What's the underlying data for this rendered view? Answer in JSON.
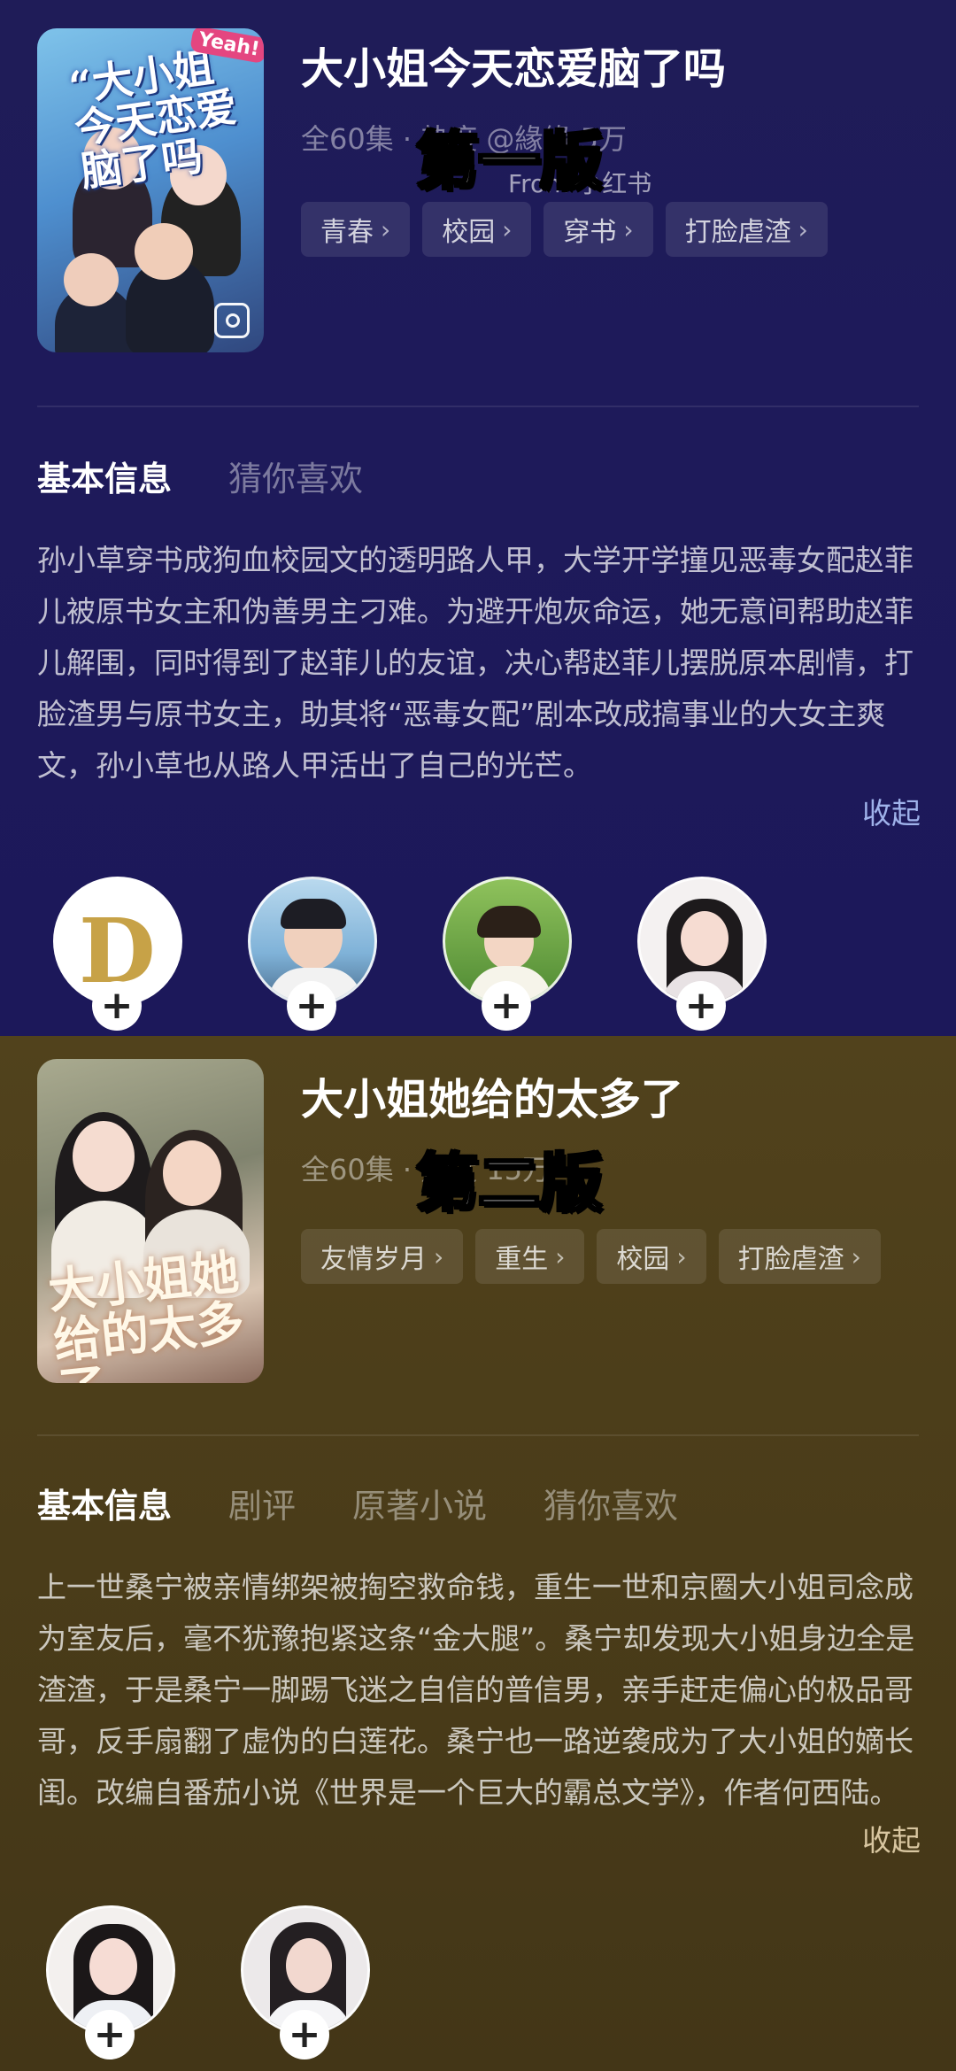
{
  "version1": {
    "title": "大小姐今天恋爱脑了吗",
    "meta": "全60集 · 热度 @緣緣 5万",
    "from": "From 小红书",
    "overlay": "第一版",
    "poster_caption": "“大小姐今天恋爱脑了吗",
    "poster_tag": "Yeah!",
    "tags": [
      "青春",
      "校园",
      "穿书",
      "打脸虐渣"
    ],
    "tabs": [
      "基本信息",
      "猜你喜欢"
    ],
    "synopsis": "孙小草穿书成狗血校园文的透明路人甲，大学开学撞见恶毒女配赵菲儿被原书女主和伪善男主刁难。为避开炮灰命运，她无意间帮助赵菲儿解围，同时得到了赵菲儿的友谊，决心帮赵菲儿摆脱原本剧情，打脸渣男与原书女主，助其将“恶毒女配”剧本改成搞事业的大女主爽文，孙小草也从路人甲活出了自己的光芒。",
    "collapse": "收起",
    "avatars": [
      "avatar-1",
      "avatar-2",
      "avatar-3",
      "avatar-4"
    ]
  },
  "version2": {
    "title": "大小姐她给的太多了",
    "meta": "全60集 · 热度 15万",
    "overlay": "第二版",
    "poster_caption": "大小姐她给的太多了",
    "tags": [
      "友情岁月",
      "重生",
      "校园",
      "打脸虐渣"
    ],
    "tabs": [
      "基本信息",
      "剧评",
      "原著小说",
      "猜你喜欢"
    ],
    "synopsis": "上一世桑宁被亲情绑架被掏空救命钱，重生一世和京圈大小姐司念成为室友后，毫不犹豫抱紧这条“金大腿”。桑宁却发现大小姐身边全是渣渣，于是桑宁一脚踢飞迷之自信的普信男，亲手赶走偏心的极品哥哥，反手扇翻了虚伪的白莲花。桑宁也一路逆袭成为了大小姐的嫡长闺。改编自番茄小说《世界是一个巨大的霸总文学》，作者何西陆。",
    "collapse": "收起",
    "avatars": [
      "avatar-1",
      "avatar-2"
    ]
  },
  "colors": {
    "panel1_bg": "#1e1a5a",
    "panel2_bg": "#4a3c19",
    "collapse_link": "#9fb2ea"
  },
  "icons": {
    "chevron": "›",
    "plus": "+",
    "save": "save-image-icon"
  }
}
